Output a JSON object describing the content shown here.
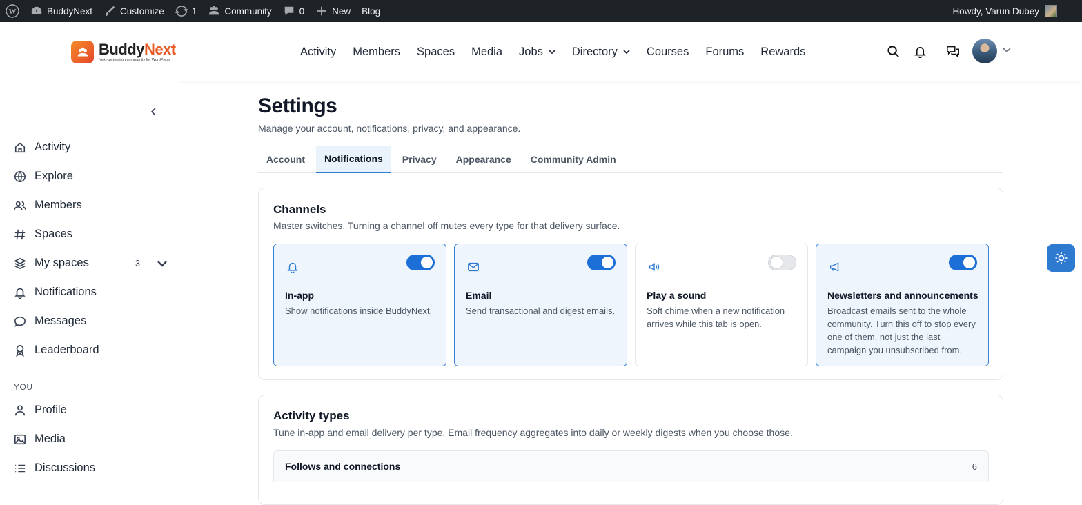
{
  "adminbar": {
    "site_name": "BuddyNext",
    "customize": "Customize",
    "updates_count": "1",
    "community": "Community",
    "comments_count": "0",
    "new": "New",
    "blog": "Blog",
    "howdy": "Howdy, Varun Dubey"
  },
  "header": {
    "logo_name_1": "Buddy",
    "logo_name_2": "Next",
    "logo_tagline": "Next-generation community for WordPress",
    "nav": [
      "Activity",
      "Members",
      "Spaces",
      "Media",
      "Jobs",
      "Directory",
      "Courses",
      "Forums",
      "Rewards"
    ]
  },
  "sidebar": {
    "items": [
      {
        "label": "Activity",
        "icon": "home-icon"
      },
      {
        "label": "Explore",
        "icon": "globe-icon"
      },
      {
        "label": "Members",
        "icon": "users-icon"
      },
      {
        "label": "Spaces",
        "icon": "hash-icon"
      },
      {
        "label": "My spaces",
        "icon": "layers-icon",
        "badge": "3"
      },
      {
        "label": "Notifications",
        "icon": "bell-icon"
      },
      {
        "label": "Messages",
        "icon": "chat-icon"
      },
      {
        "label": "Leaderboard",
        "icon": "award-icon"
      }
    ],
    "section_you": "YOU",
    "you_items": [
      {
        "label": "Profile",
        "icon": "user-icon"
      },
      {
        "label": "Media",
        "icon": "image-icon"
      },
      {
        "label": "Discussions",
        "icon": "list-icon"
      }
    ]
  },
  "main": {
    "title": "Settings",
    "subtitle": "Manage your account, notifications, privacy, and appearance.",
    "tabs": [
      "Account",
      "Notifications",
      "Privacy",
      "Appearance",
      "Community Admin"
    ],
    "active_tab": "Notifications",
    "channels": {
      "title": "Channels",
      "subtitle": "Master switches. Turning a channel off mutes every type for that delivery surface.",
      "items": [
        {
          "title": "In-app",
          "desc": "Show notifications inside BuddyNext.",
          "enabled": true,
          "icon": "bell-icon"
        },
        {
          "title": "Email",
          "desc": "Send transactional and digest emails.",
          "enabled": true,
          "icon": "mail-icon"
        },
        {
          "title": "Play a sound",
          "desc": "Soft chime when a new notification arrives while this tab is open.",
          "enabled": false,
          "icon": "speaker-icon"
        },
        {
          "title": "Newsletters and announcements",
          "desc": "Broadcast emails sent to the whole community. Turn this off to stop every one of them, not just the last campaign you unsubscribed from.",
          "enabled": true,
          "icon": "megaphone-icon"
        }
      ]
    },
    "activity_types": {
      "title": "Activity types",
      "subtitle": "Tune in-app and email delivery per type. Email frequency aggregates into daily or weekly digests when you choose those.",
      "groups": [
        {
          "label": "Follows and connections",
          "count": "6"
        }
      ]
    }
  },
  "colors": {
    "accent": "#1d6fd8",
    "brand_orange": "#ea5a24",
    "adminbar": "#1d2327"
  }
}
